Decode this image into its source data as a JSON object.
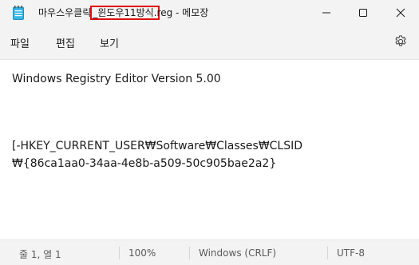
{
  "window": {
    "title_prefix": "마우스우클릭",
    "title_highlight": "_윈도우11방식.",
    "title_suffix": "reg - 메모장",
    "app_icon": "notepad-icon"
  },
  "window_controls": {
    "minimize_icon": "minimize-icon",
    "maximize_icon": "maximize-icon",
    "close_icon": "close-icon"
  },
  "menu": {
    "file_label": "파일",
    "edit_label": "편집",
    "view_label": "보기",
    "settings_icon": "gear-icon"
  },
  "editor": {
    "lines": [
      "Windows Registry Editor Version 5.00",
      "[-HKEY_CURRENT_USER₩Software₩Classes₩CLSID",
      "₩{86ca1aa0-34aa-4e8b-a509-50c905bae2a2}"
    ]
  },
  "status": {
    "position": "줄 1, 열 1",
    "zoom": "100%",
    "line_ending": "Windows (CRLF)",
    "encoding": "UTF-8"
  },
  "colors": {
    "highlight_border": "#e01010",
    "background": "#f3f3f3",
    "editor_background": "#ffffff"
  }
}
